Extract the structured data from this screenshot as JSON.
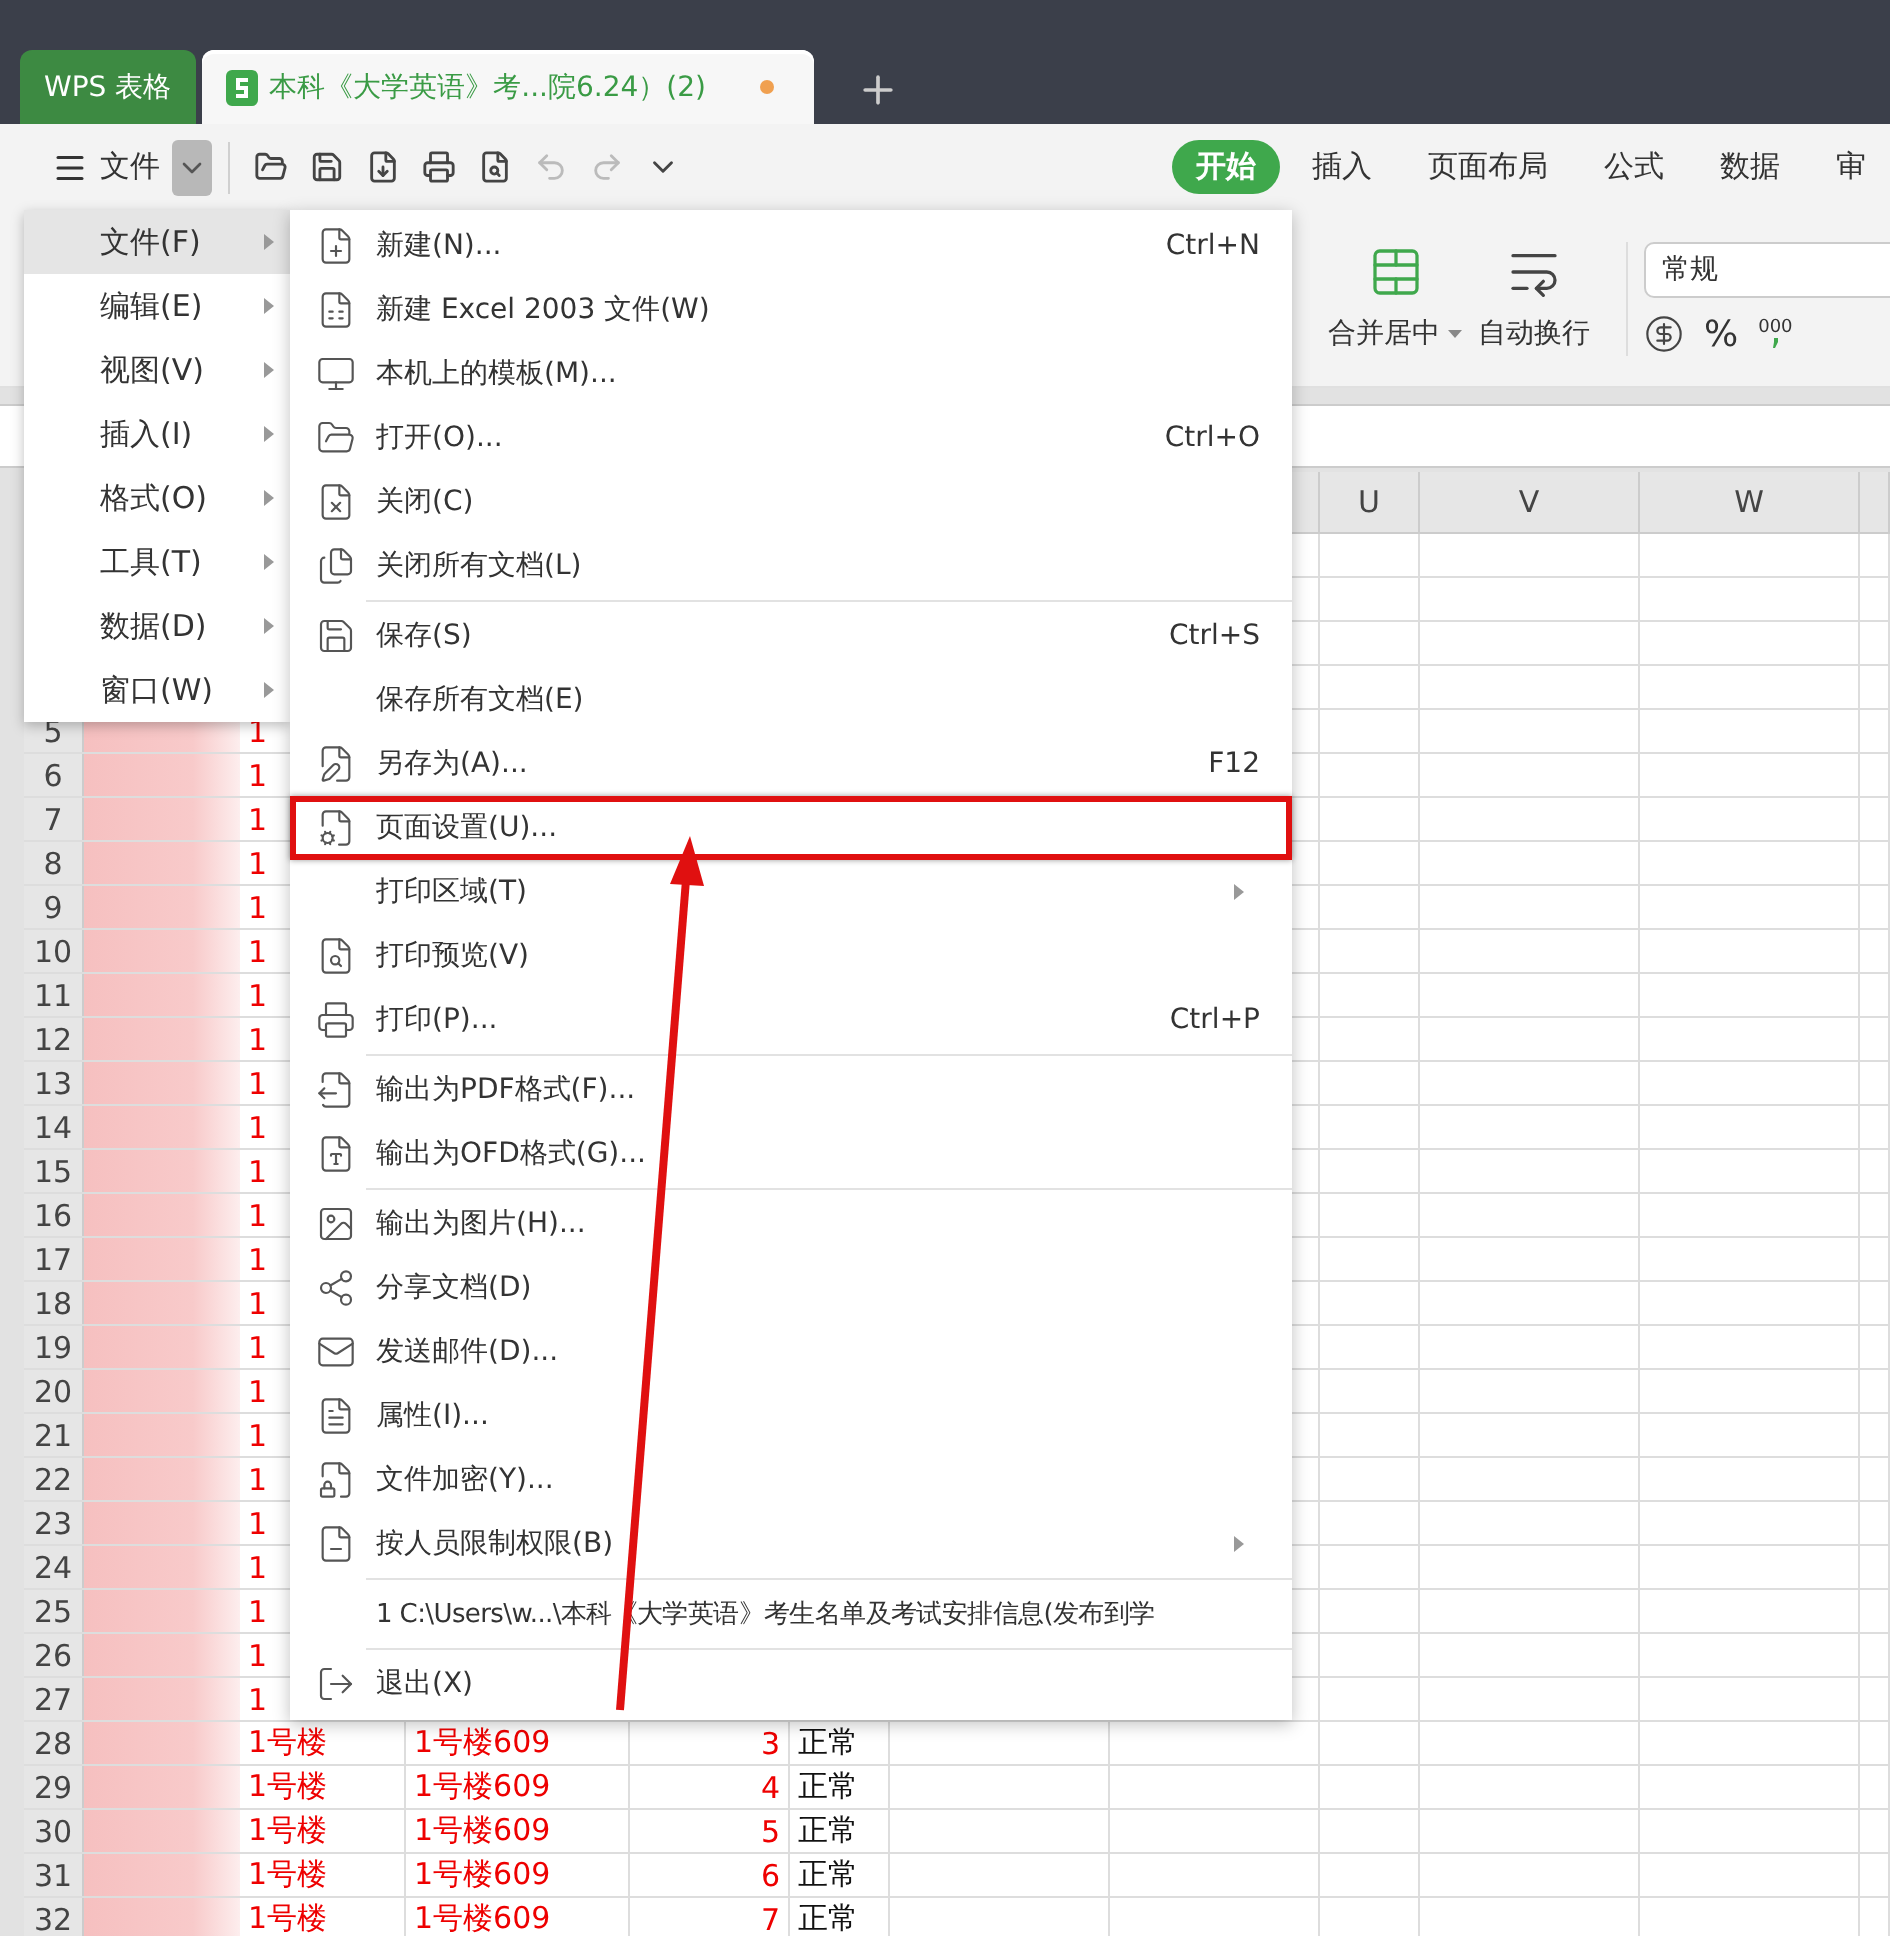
{
  "app_tabs": [
    {
      "label": "WPS 表格",
      "kind": "home",
      "selected": false
    },
    {
      "label": "本科《大学英语》考...院6.24）(2)",
      "kind": "document",
      "selected": true,
      "unsaved": true
    }
  ],
  "toolbar": {
    "menu_label": "文件",
    "menu_dropdown_open": true,
    "quick_access": [
      {
        "disabled": false
      },
      {
        "disabled": false
      },
      {
        "disabled": false
      },
      {
        "disabled": false
      },
      {
        "disabled": false
      },
      {
        "disabled": true
      },
      {
        "disabled": true
      },
      {
        "disabled": false
      }
    ],
    "ribbon_tabs": [
      {
        "label": "开始",
        "selected": true
      },
      {
        "label": "插入",
        "selected": false
      },
      {
        "label": "页面布局",
        "selected": false
      },
      {
        "label": "公式",
        "selected": false
      },
      {
        "label": "数据",
        "selected": false
      },
      {
        "label": "审",
        "selected": false
      }
    ]
  },
  "ribbon": {
    "merge_label": "合并居中",
    "wrap_label": "自动换行",
    "number_format": "常规",
    "percent": "%",
    "thousands": "000"
  },
  "sheet": {
    "columns": [
      "U",
      "V",
      "W"
    ],
    "rows": [
      {
        "number": "5",
        "cells": [
          "1"
        ]
      },
      {
        "number": "6",
        "cells": [
          "1"
        ]
      },
      {
        "number": "7",
        "cells": [
          "1"
        ]
      },
      {
        "number": "8",
        "cells": [
          "1"
        ]
      },
      {
        "number": "9",
        "cells": [
          "1"
        ]
      },
      {
        "number": "10",
        "cells": [
          "1"
        ]
      },
      {
        "number": "11",
        "cells": [
          "1"
        ]
      },
      {
        "number": "12",
        "cells": [
          "1"
        ]
      },
      {
        "number": "13",
        "cells": [
          "1"
        ]
      },
      {
        "number": "14",
        "cells": [
          "1"
        ]
      },
      {
        "number": "15",
        "cells": [
          "1"
        ]
      },
      {
        "number": "16",
        "cells": [
          "1"
        ]
      },
      {
        "number": "17",
        "cells": [
          "1"
        ]
      },
      {
        "number": "18",
        "cells": [
          "1"
        ]
      },
      {
        "number": "19",
        "cells": [
          "1"
        ]
      },
      {
        "number": "20",
        "cells": [
          "1"
        ]
      },
      {
        "number": "21",
        "cells": [
          "1"
        ]
      },
      {
        "number": "22",
        "cells": [
          "1"
        ]
      },
      {
        "number": "23",
        "cells": [
          "1"
        ]
      },
      {
        "number": "24",
        "cells": [
          "1"
        ]
      },
      {
        "number": "25",
        "cells": [
          "1"
        ]
      },
      {
        "number": "26",
        "cells": [
          "1"
        ]
      },
      {
        "number": "27",
        "cells": [
          "1"
        ]
      },
      {
        "number": "28",
        "cells": [
          "1号楼",
          "1号楼609",
          "3",
          "正常"
        ]
      },
      {
        "number": "29",
        "cells": [
          "1号楼",
          "1号楼609",
          "4",
          "正常"
        ]
      },
      {
        "number": "30",
        "cells": [
          "1号楼",
          "1号楼609",
          "5",
          "正常"
        ]
      },
      {
        "number": "31",
        "cells": [
          "1号楼",
          "1号楼609",
          "6",
          "正常"
        ]
      },
      {
        "number": "32",
        "cells": [
          "1号楼",
          "1号楼609",
          "7",
          "正常"
        ]
      }
    ]
  },
  "main_menu": [
    {
      "label": "文件(F)",
      "selected": true
    },
    {
      "label": "编辑(E)",
      "selected": false
    },
    {
      "label": "视图(V)",
      "selected": false
    },
    {
      "label": "插入(I)",
      "selected": false
    },
    {
      "label": "格式(O)",
      "selected": false
    },
    {
      "label": "工具(T)",
      "selected": false
    },
    {
      "label": "数据(D)",
      "selected": false
    },
    {
      "label": "窗口(W)",
      "selected": false
    }
  ],
  "file_menu": [
    {
      "kind": "item",
      "label": "新建(N)...",
      "shortcut": "Ctrl+N"
    },
    {
      "kind": "item",
      "label": "新建 Excel 2003 文件(W)"
    },
    {
      "kind": "item",
      "label": "本机上的模板(M)..."
    },
    {
      "kind": "item",
      "label": "打开(O)...",
      "shortcut": "Ctrl+O"
    },
    {
      "kind": "item",
      "label": "关闭(C)"
    },
    {
      "kind": "item",
      "label": "关闭所有文档(L)"
    },
    {
      "kind": "separator"
    },
    {
      "kind": "item",
      "label": "保存(S)",
      "shortcut": "Ctrl+S"
    },
    {
      "kind": "item",
      "label": "保存所有文档(E)"
    },
    {
      "kind": "item",
      "label": "另存为(A)...",
      "shortcut": "F12"
    },
    {
      "kind": "item",
      "label": "页面设置(U)...",
      "highlighted": true
    },
    {
      "kind": "item",
      "label": "打印区域(T)",
      "submenu": true
    },
    {
      "kind": "item",
      "label": "打印预览(V)"
    },
    {
      "kind": "item",
      "label": "打印(P)...",
      "shortcut": "Ctrl+P"
    },
    {
      "kind": "separator"
    },
    {
      "kind": "item",
      "label": "输出为PDF格式(F)..."
    },
    {
      "kind": "item",
      "label": "输出为OFD格式(G)..."
    },
    {
      "kind": "separator"
    },
    {
      "kind": "item",
      "label": "输出为图片(H)..."
    },
    {
      "kind": "item",
      "label": "分享文档(D)"
    },
    {
      "kind": "item",
      "label": "发送邮件(D)..."
    },
    {
      "kind": "item",
      "label": "属性(I)..."
    },
    {
      "kind": "item",
      "label": "文件加密(Y)..."
    },
    {
      "kind": "item",
      "label": "按人员限制权限(B)",
      "submenu": true
    },
    {
      "kind": "separator"
    },
    {
      "kind": "recent",
      "label": "1 C:\\Users\\w...\\本科《大学英语》考生名单及考试安排信息(发布到学"
    },
    {
      "kind": "separator"
    },
    {
      "kind": "item",
      "label": "退出(X)"
    }
  ]
}
